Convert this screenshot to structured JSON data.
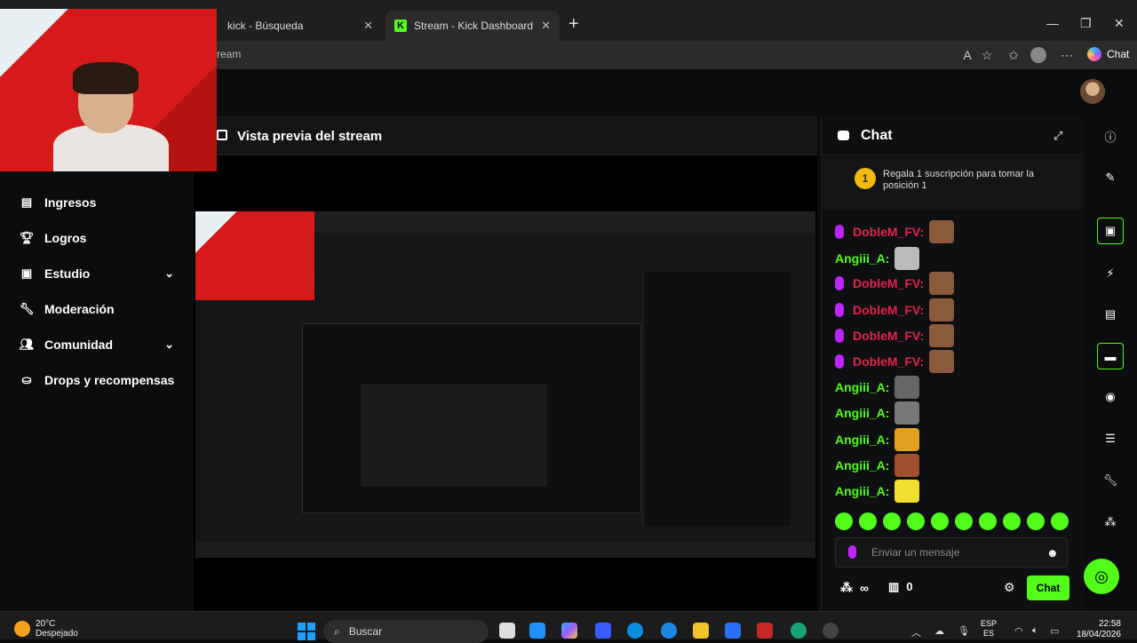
{
  "browser": {
    "tabs": [
      {
        "label": "kick - Búsqueda"
      },
      {
        "label": "Stream - Kick Dashboard",
        "active": true
      }
    ],
    "url": "ream",
    "copilot_label": "Chat"
  },
  "sidebar": {
    "items": [
      {
        "label": "Ingresos",
        "icon": "chart-icon"
      },
      {
        "label": "Logros",
        "icon": "trophy-icon"
      },
      {
        "label": "Estudio",
        "icon": "studio-icon",
        "expandable": true
      },
      {
        "label": "Moderación",
        "icon": "wrench-icon"
      },
      {
        "label": "Comunidad",
        "icon": "community-icon",
        "expandable": true
      },
      {
        "label": "Drops y recompensas",
        "icon": "drops-icon"
      }
    ]
  },
  "preview": {
    "title": "Vista previa del stream"
  },
  "chat": {
    "title": "Chat",
    "sub_banner": {
      "rank": "1",
      "text": "Regala 1 suscripción para tomar la posición 1"
    },
    "messages": [
      {
        "user": "DobleM_FV:",
        "color": "#e8214a",
        "mic": true
      },
      {
        "user": "Angiii_A:",
        "color": "#53fc18",
        "mic": false
      },
      {
        "user": "DobleM_FV:",
        "color": "#e8214a",
        "mic": true
      },
      {
        "user": "DobleM_FV:",
        "color": "#e8214a",
        "mic": true
      },
      {
        "user": "DobleM_FV:",
        "color": "#e8214a",
        "mic": true
      },
      {
        "user": "DobleM_FV:",
        "color": "#e8214a",
        "mic": true
      },
      {
        "user": "Angiii_A:",
        "color": "#53fc18",
        "mic": false
      },
      {
        "user": "Angiii_A:",
        "color": "#53fc18",
        "mic": false
      },
      {
        "user": "Angiii_A:",
        "color": "#53fc18",
        "mic": false
      },
      {
        "user": "Angiii_A:",
        "color": "#53fc18",
        "mic": false
      },
      {
        "user": "Angiii_A:",
        "color": "#53fc18",
        "mic": false
      }
    ],
    "input_placeholder": "Enviar un mensaje",
    "points_value": "∞",
    "gift_count": "0",
    "send_label": "Chat"
  },
  "taskbar": {
    "weather_temp": "20°C",
    "weather_desc": "Despejado",
    "search_label": "Buscar",
    "lang_top": "ESP",
    "lang_bottom": "ES",
    "time": "22:58",
    "date": "18/04/2026"
  },
  "colors": {
    "accent": "#53fc18",
    "subscriber": "#e8214a",
    "mic": "#c024ff"
  }
}
